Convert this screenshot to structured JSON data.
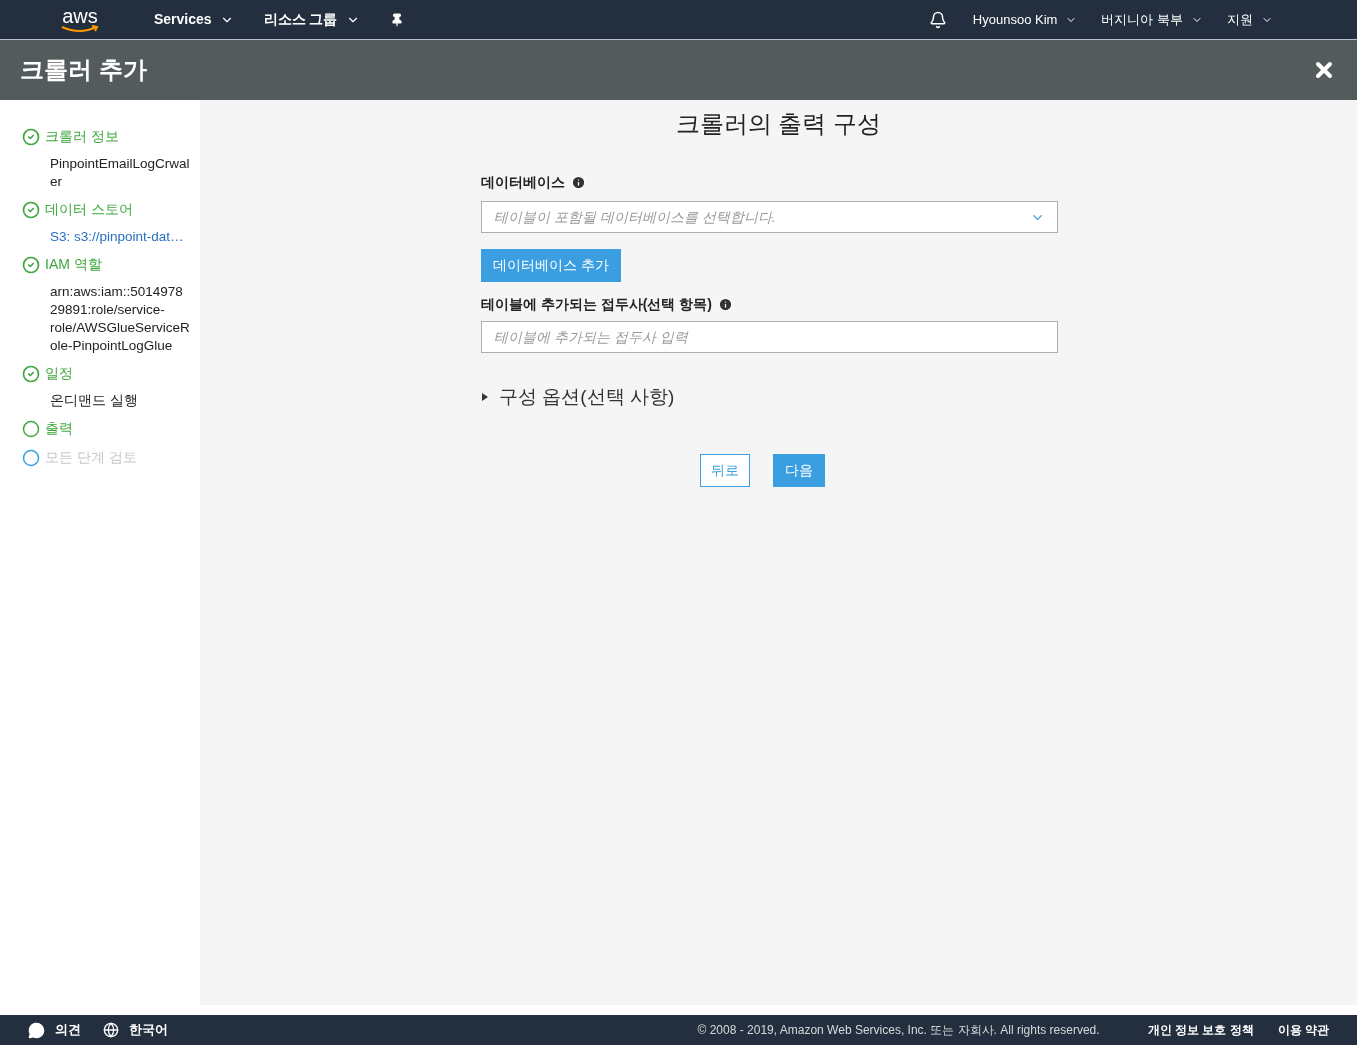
{
  "top_nav": {
    "logo": "aws",
    "menus": [
      {
        "label": "Services"
      },
      {
        "label": "리소스 그룹"
      }
    ],
    "right_menus": [
      {
        "label": "Hyounsoo Kim"
      },
      {
        "label": "버지니아 북부"
      },
      {
        "label": "지원"
      }
    ]
  },
  "header": {
    "title": "크롤러 추가"
  },
  "steps": [
    {
      "label": "크롤러 정보",
      "kind": "done",
      "detail": {
        "text": "PinpointEmailLogCrwaler",
        "link": false
      }
    },
    {
      "label": "데이터 스토어",
      "kind": "done",
      "detail": {
        "text": "S3: s3://pinpoint-dat…",
        "link": true
      }
    },
    {
      "label": "IAM 역할",
      "kind": "done",
      "detail": {
        "text": "arn:aws:iam::501497829891:role/service-role/AWSGlueServiceRole-PinpointLogGlue",
        "link": false
      }
    },
    {
      "label": "일정",
      "kind": "done",
      "detail": {
        "text": "온디맨드 실행",
        "link": false
      }
    },
    {
      "label": "출력",
      "kind": "current"
    },
    {
      "label": "모든 단계 검토",
      "kind": "pending"
    }
  ],
  "form": {
    "title": "크롤러의 출력 구성",
    "database_label": "데이터베이스",
    "database_placeholder": "테이블이 포함될 데이터베이스를 선택합니다.",
    "add_database_button": "데이터베이스 추가",
    "prefix_label": "테이블에 추가되는 접두사(선택 항목)",
    "prefix_placeholder": "테이블에 추가되는 접두사 입력",
    "options_section": {
      "label": "구성 옵션(선택 사항)",
      "expanded": false
    },
    "back_button": "뒤로",
    "next_button": "다음"
  },
  "footer": {
    "feedback": "의견",
    "language": "한국어",
    "copyright": "© 2008 - 2019, Amazon Web Services, Inc. 또는 자회사. All rights reserved.",
    "links": [
      "개인 정보 보호 정책",
      "이용 약관"
    ]
  }
}
